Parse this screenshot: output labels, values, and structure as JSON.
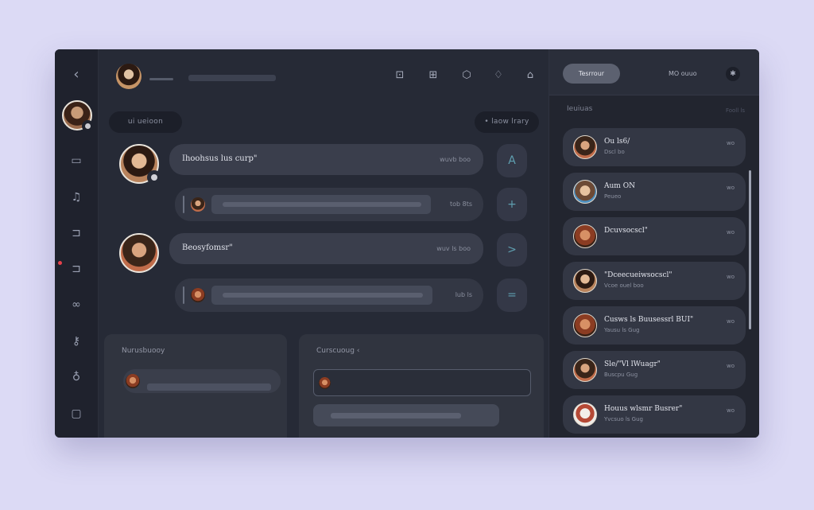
{
  "window": {
    "rail": {
      "back_icon": "chevron-left-icon",
      "icons": [
        "card-icon",
        "headphones-icon",
        "folder-icon",
        "folder-alert-icon",
        "link-icon",
        "key-icon",
        "mic-icon",
        "grid-icon"
      ]
    },
    "header": {
      "toolbar_icons": [
        "chat-icon",
        "image-icon",
        "tag-icon",
        "bell-icon",
        "bookmark-icon"
      ]
    },
    "filters": {
      "left_pill": "ui ueioon",
      "right_pill": "• laow lrary"
    },
    "messages": [
      {
        "title": "Ihoohsus lus curp\"",
        "time": "wuvb boo"
      },
      {
        "title": "Beosyfomsr\"",
        "time": "wuv ls boo"
      }
    ],
    "replies": [
      {
        "time": "tob 8ts"
      },
      {
        "time": "lub ls"
      }
    ],
    "side_buttons": [
      "A",
      "+",
      ">",
      "="
    ],
    "panels": {
      "left_title": "Nurusbuooy",
      "right_title": "Curscuoug ‹"
    },
    "right": {
      "pill": "Tesrrour",
      "top_label": "MO ouuo",
      "header": "Ieuiuas",
      "header_right": "Fooll ls",
      "contacts": [
        {
          "name": "Ou ls6/",
          "sub": "Dscl bo",
          "time": "wo"
        },
        {
          "name": "Aum ON",
          "sub": "Peueo",
          "time": "wo"
        },
        {
          "name": "Dcuvsocscl\"",
          "sub": "",
          "time": "wo"
        },
        {
          "name": "\"Dceecueiwsocscl\"",
          "sub": "Vcoe ouel boo",
          "time": "wo"
        },
        {
          "name": "Cusws ls Buusessrl BUI\"",
          "sub": "Yausu ls Gug",
          "time": "wo"
        },
        {
          "name": "Sle/\"Vl lWuagr\"",
          "sub": "Buscpu Gug",
          "time": "wo"
        },
        {
          "name": "Houus wlsmr Busrer\"",
          "sub": "Yvcsuo ls Gug",
          "time": "wo"
        }
      ]
    }
  }
}
